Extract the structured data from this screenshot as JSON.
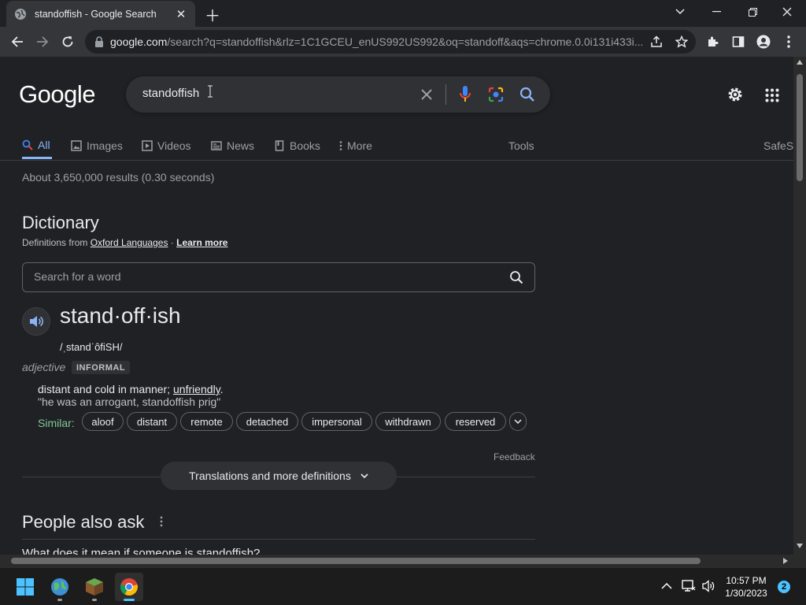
{
  "browser": {
    "tab_title": "standoffish - Google Search",
    "url_domain": "google.com",
    "url_path": "/search?q=standoffish&rlz=1C1GCEU_enUS992US992&oq=standoff&aqs=chrome.0.0i131i433i..."
  },
  "search": {
    "logo_text": "Google",
    "query": "standoffish"
  },
  "nav": {
    "all": "All",
    "images": "Images",
    "videos": "Videos",
    "news": "News",
    "books": "Books",
    "more": "More",
    "tools": "Tools",
    "safesearch": "SafeS"
  },
  "results": {
    "stats": "About 3,650,000 results (0.30 seconds)"
  },
  "dictionary": {
    "title": "Dictionary",
    "source_prefix": "Definitions from ",
    "source_link": "Oxford Languages",
    "source_sep": " · ",
    "learn_more": "Learn more",
    "word_search_placeholder": "Search for a word",
    "headword": "stand·off·ish",
    "phonetic": "/ˌstandˈôfiSH/",
    "part_of_speech": "adjective",
    "register": "INFORMAL",
    "definition": "distant and cold in manner; ",
    "definition_link": "unfriendly",
    "definition_end": ".",
    "example": "\"he was an arrogant, standoffish prig\"",
    "similar_label": "Similar:",
    "similar": [
      "aloof",
      "distant",
      "remote",
      "detached",
      "impersonal",
      "withdrawn",
      "reserved"
    ],
    "feedback": "Feedback",
    "more_definitions": "Translations and more definitions"
  },
  "people_also_ask": {
    "title": "People also ask",
    "first_question": "What does it mean if someone is standoffish?"
  },
  "taskbar": {
    "time": "10:57 PM",
    "date": "1/30/2023",
    "notification_count": "2"
  },
  "colors": {
    "background": "#202124",
    "link_blue": "#8ab4f8",
    "similar_green": "#81c995"
  }
}
